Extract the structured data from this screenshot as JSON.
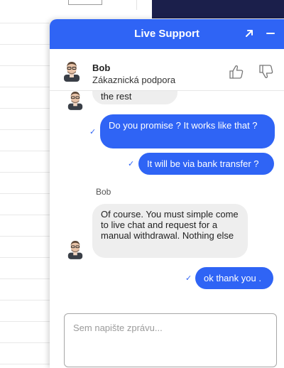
{
  "widget": {
    "title": "Live Support"
  },
  "agent": {
    "name": "Bob",
    "role": "Zákaznická podpora"
  },
  "messages": [
    {
      "side": "in",
      "text": "the rest"
    },
    {
      "side": "out",
      "text": "Do you promise ? It works like that ?",
      "read": "✓"
    },
    {
      "side": "out",
      "text": "It will be via bank transfer ?",
      "read": "✓"
    },
    {
      "side": "sender",
      "text": "Bob"
    },
    {
      "side": "in",
      "text": "Of course. You must simple come to live chat and request for a manual withdrawal. Nothing else"
    },
    {
      "side": "out",
      "text": "ok thank you .",
      "read": "✓"
    }
  ],
  "composer": {
    "placeholder": "Sem napište zprávu..."
  },
  "colors": {
    "brand": "#2f64f5",
    "incoming_bubble": "#eeeeee",
    "page_header_dark": "#1b1f4b"
  },
  "icons": {
    "expand": "expand-arrow-icon",
    "minimize": "minimize-icon",
    "like": "thumbs-up-icon",
    "dislike": "thumbs-down-icon",
    "read": "checkmark-icon"
  }
}
